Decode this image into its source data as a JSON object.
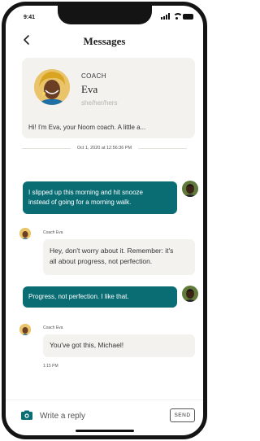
{
  "status_bar": {
    "time": "9:41"
  },
  "header": {
    "title": "Messages",
    "back_icon": "chevron-left-icon"
  },
  "coach_card": {
    "role": "COACH",
    "name": "Eva",
    "pronouns": "she/her/hers",
    "intro": "Hi! I'm Eva, your Noom coach. A little a..."
  },
  "thread": {
    "timestamp": "Oct 1, 2020 at 12:56:36 PM",
    "messages": [
      {
        "from": "user",
        "text_lines": [
          "I slipped up this morning and hit snooze",
          "instead of going for a morning walk."
        ]
      },
      {
        "from": "coach",
        "sender": "Coach Eva",
        "text_lines": [
          "Hey, don't worry about it. Remember: it's",
          "all about progress, not perfection."
        ]
      },
      {
        "from": "user",
        "text_lines": [
          "Progress, not perfection. I like that."
        ]
      },
      {
        "from": "coach",
        "sender": "Coach Eva",
        "text_lines": [
          "You've got this, Michael!"
        ],
        "time": "1:15 PM"
      }
    ]
  },
  "composer": {
    "placeholder": "Write a reply",
    "send_label": "SEND",
    "camera_icon": "camera-icon"
  },
  "colors": {
    "accent": "#0a6d74",
    "card_bg": "#f3f2ee"
  }
}
